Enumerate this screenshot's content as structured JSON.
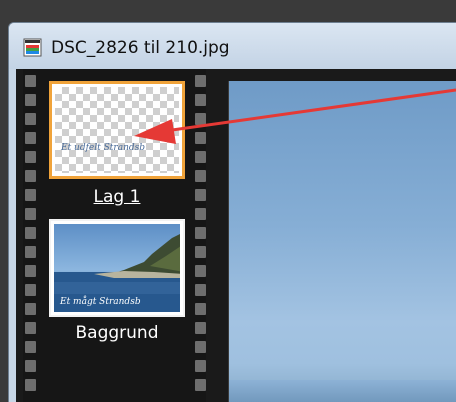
{
  "window": {
    "title": "DSC_2826 til 210.jpg",
    "icon": "image-file-icon"
  },
  "layers": [
    {
      "name": "Lag 1",
      "thumbnail_caption": "Et udfelt Strandsb",
      "selected": true,
      "underlined": true
    },
    {
      "name": "Baggrund",
      "thumbnail_caption": "Et mågt Strandsb",
      "selected": false,
      "underlined": false
    }
  ],
  "colors": {
    "selection_border": "#f0a33a",
    "annotation_arrow": "#e53935",
    "film_strip": "#161616",
    "sky": "#86aed5"
  }
}
